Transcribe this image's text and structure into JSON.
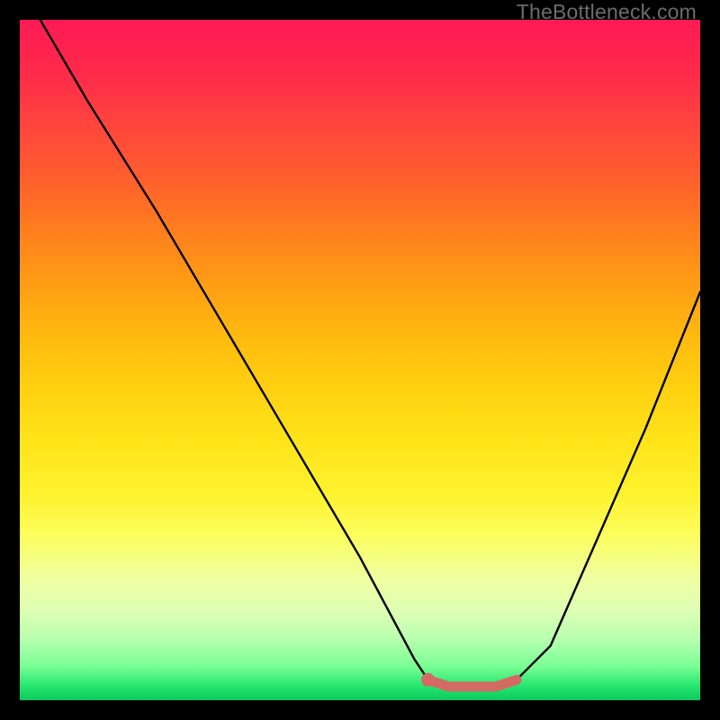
{
  "watermark": "TheBottleneck.com",
  "chart_data": {
    "type": "line",
    "title": "",
    "xlabel": "",
    "ylabel": "",
    "xlim": [
      0,
      100
    ],
    "ylim": [
      0,
      100
    ],
    "background_gradient_note": "vertical gradient red(top)→yellow(mid)→green(bottom), value encodes badness; low y = good",
    "series": [
      {
        "name": "bottleneck-curve",
        "color": "#000000",
        "x": [
          3,
          10,
          20,
          30,
          40,
          50,
          58,
          60,
          63,
          66,
          70,
          73,
          78,
          85,
          92,
          100
        ],
        "y": [
          100,
          88,
          72,
          55,
          38,
          21,
          6,
          3,
          2,
          2,
          2,
          3,
          8,
          24,
          40,
          60
        ]
      },
      {
        "name": "optimal-range-marker",
        "color": "#d46a63",
        "x": [
          60,
          63,
          66,
          70,
          73
        ],
        "y": [
          3,
          2,
          2,
          2,
          3
        ]
      }
    ],
    "optimal_point": {
      "x": 60,
      "y": 3
    }
  }
}
